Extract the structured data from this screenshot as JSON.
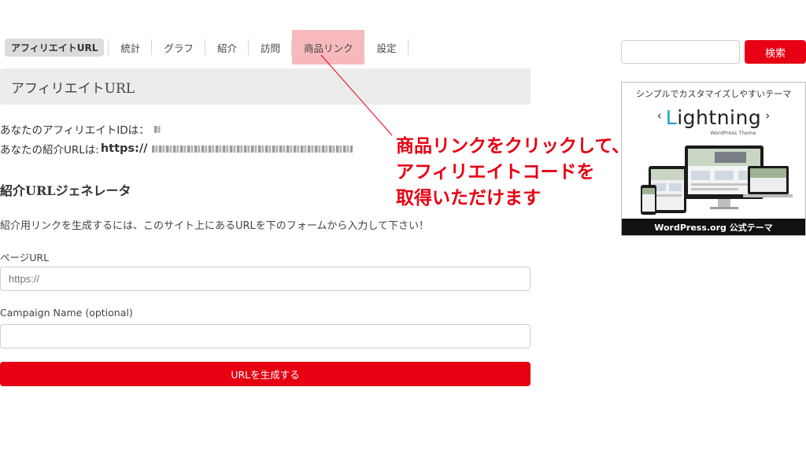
{
  "tabs": [
    {
      "label": "アフィリエイトURL",
      "active": true
    },
    {
      "label": "統計"
    },
    {
      "label": "グラフ"
    },
    {
      "label": "紹介"
    },
    {
      "label": "訪問"
    },
    {
      "label": "商品リンク",
      "highlighted": true
    },
    {
      "label": "設定"
    }
  ],
  "main": {
    "heading": "アフィリエイトURL",
    "affiliate_id_label": "あなたのアフィリエイトIDは：",
    "referral_url_label": "あなたの紹介URLは:",
    "referral_url_prefix": "https://",
    "generator": {
      "title": "紹介URLジェネレータ",
      "help": "紹介用リンクを生成するには、このサイト上にあるURLを下のフォームから入力して下さい！",
      "page_url_label": "ページURL",
      "page_url_placeholder": "https://",
      "campaign_label": "Campaign Name (optional)",
      "campaign_placeholder": "",
      "submit_label": "URLを生成する"
    }
  },
  "sidebar": {
    "search_placeholder": "",
    "search_button": "検索",
    "ad": {
      "tagline": "シンプルでカスタマイズしやすいテーマ",
      "logo_left_arrow": "‹",
      "logo_first": "L",
      "logo_rest": "ightning",
      "logo_right_arrow": "›",
      "logo_sub": "WordPress Theme",
      "footer": "WordPress.org 公式テーマ"
    }
  },
  "annotation": {
    "lines": [
      "商品リンクをクリックして、",
      "アフィリエイトコードを",
      "取得いただけます"
    ],
    "color": "#e60012"
  },
  "colors": {
    "accent": "#e60012",
    "highlight": "#f7b9bd",
    "heading_bg": "#ececec"
  }
}
